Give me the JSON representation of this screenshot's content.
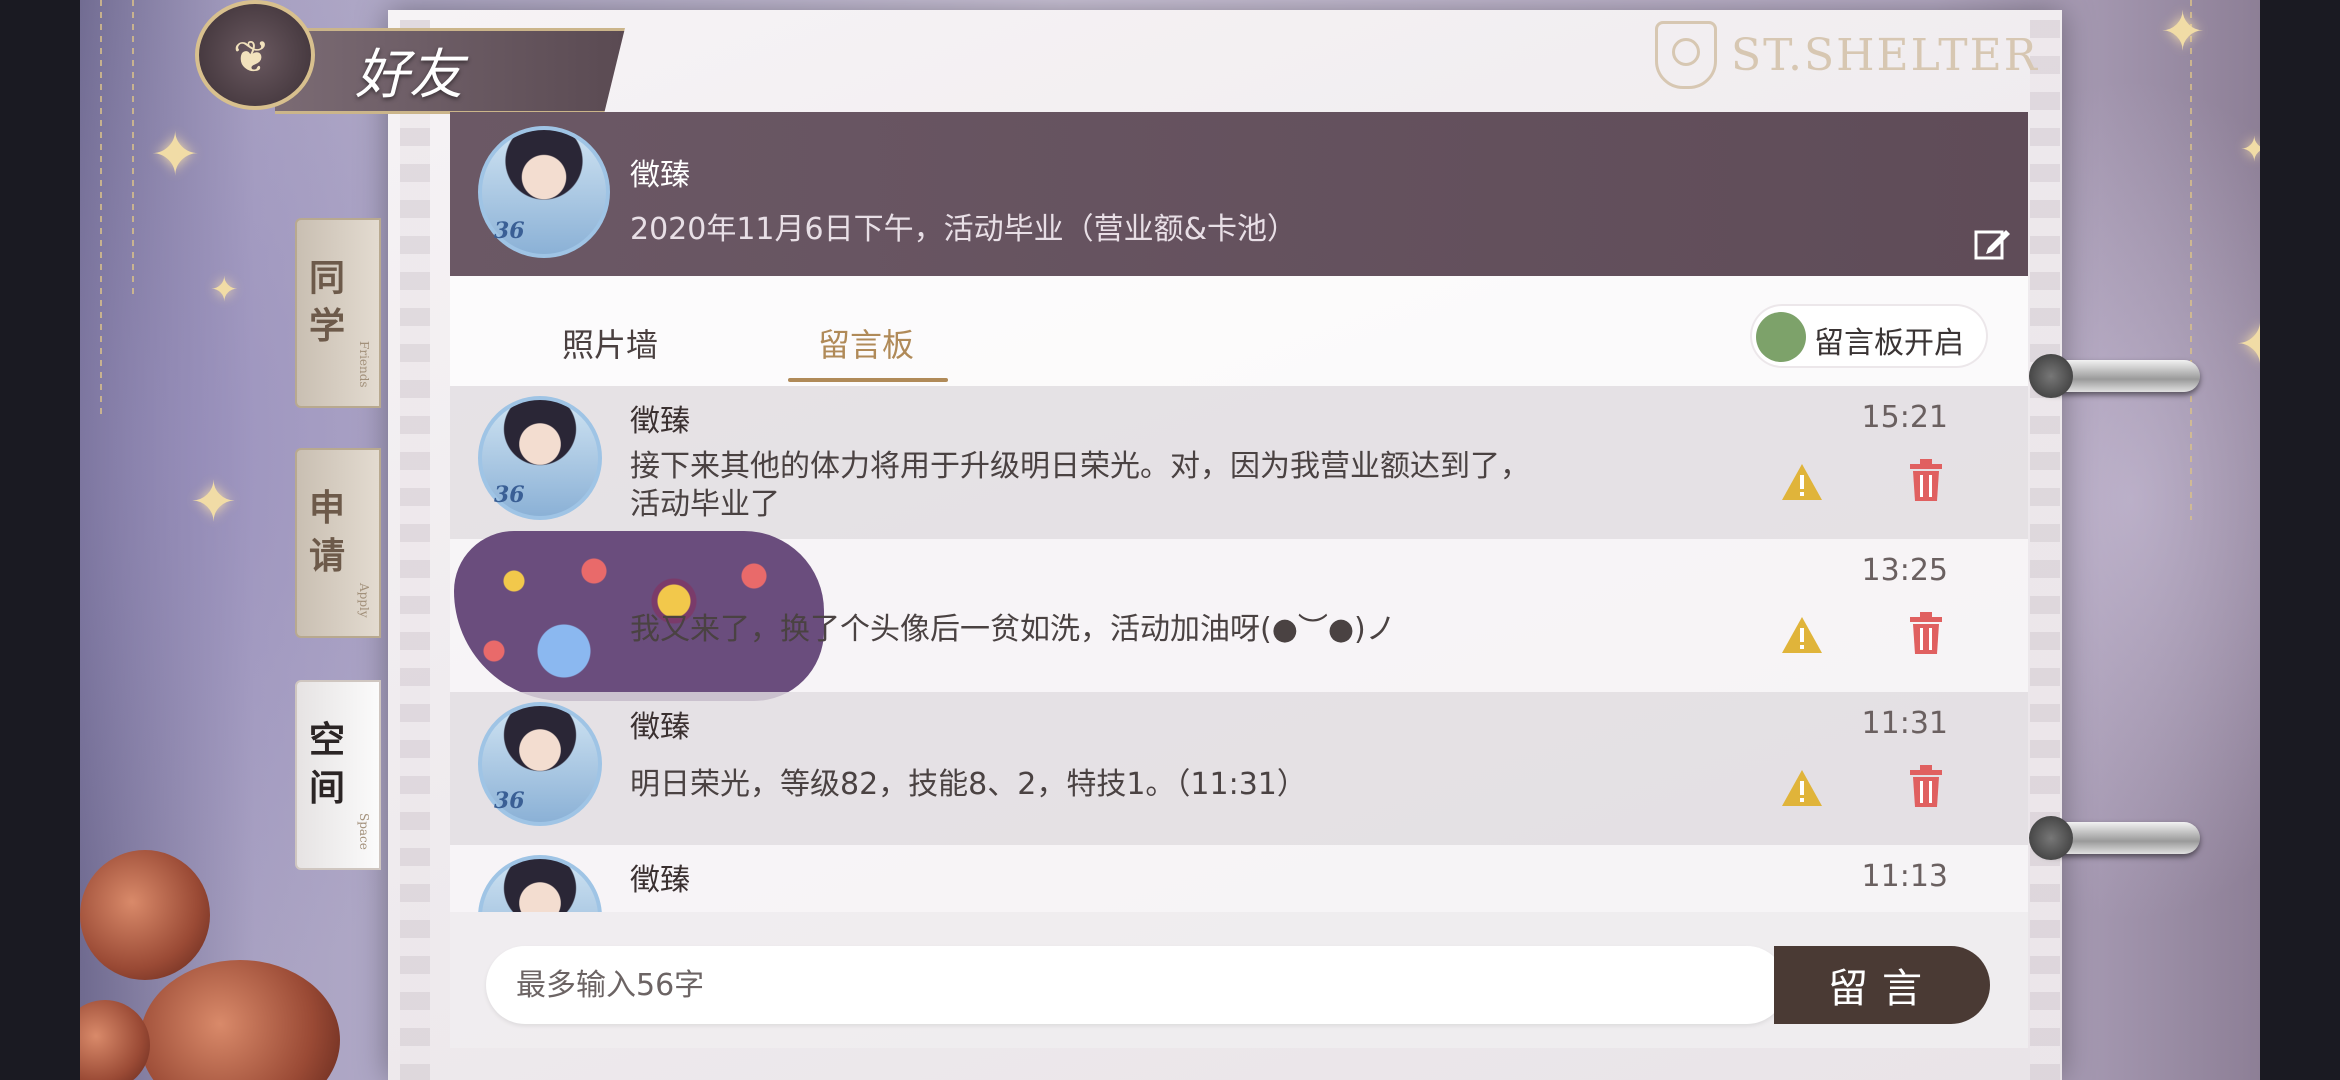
{
  "header": {
    "title": "好友",
    "brand": "ST.SHELTER"
  },
  "side_tabs": [
    {
      "label": "同学",
      "sub": "Friends",
      "active": false
    },
    {
      "label": "申请",
      "sub": "Apply",
      "active": false
    },
    {
      "label": "空间",
      "sub": "Space",
      "active": true
    }
  ],
  "profile": {
    "name": "徵臻",
    "signature": "2020年11月6日下午，活动毕业（营业额&卡池）",
    "level": "36",
    "edit_icon": "edit-icon"
  },
  "tabs": [
    {
      "label": "照片墙",
      "active": false
    },
    {
      "label": "留言板",
      "active": true
    }
  ],
  "toggle": {
    "label": "留言板开启",
    "on": true,
    "color": "#7da26a"
  },
  "messages": [
    {
      "name": "徵臻",
      "level": "36",
      "time": "15:21",
      "text": "接下来其他的体力将用于升级明日荣光。对，因为我营业额达到了，活动毕业了"
    },
    {
      "name": "",
      "level": "",
      "time": "13:25",
      "text": "我又来了，换了个头像后一贫如洗，活动加油呀(●︶●)ノ"
    },
    {
      "name": "徵臻",
      "level": "36",
      "time": "11:31",
      "text": "明日荣光，等级82，技能8、2，特技1。（11:31）"
    },
    {
      "name": "徵臻",
      "level": "",
      "time": "11:13",
      "text": ""
    }
  ],
  "composer": {
    "placeholder": "最多输入56字",
    "send_label": "留言"
  },
  "colors": {
    "accent": "#b08a58",
    "header_bg": "#6b5865",
    "warn": "#e0b43a",
    "delete": "#e06060",
    "send_bg": "#4a3a34"
  }
}
